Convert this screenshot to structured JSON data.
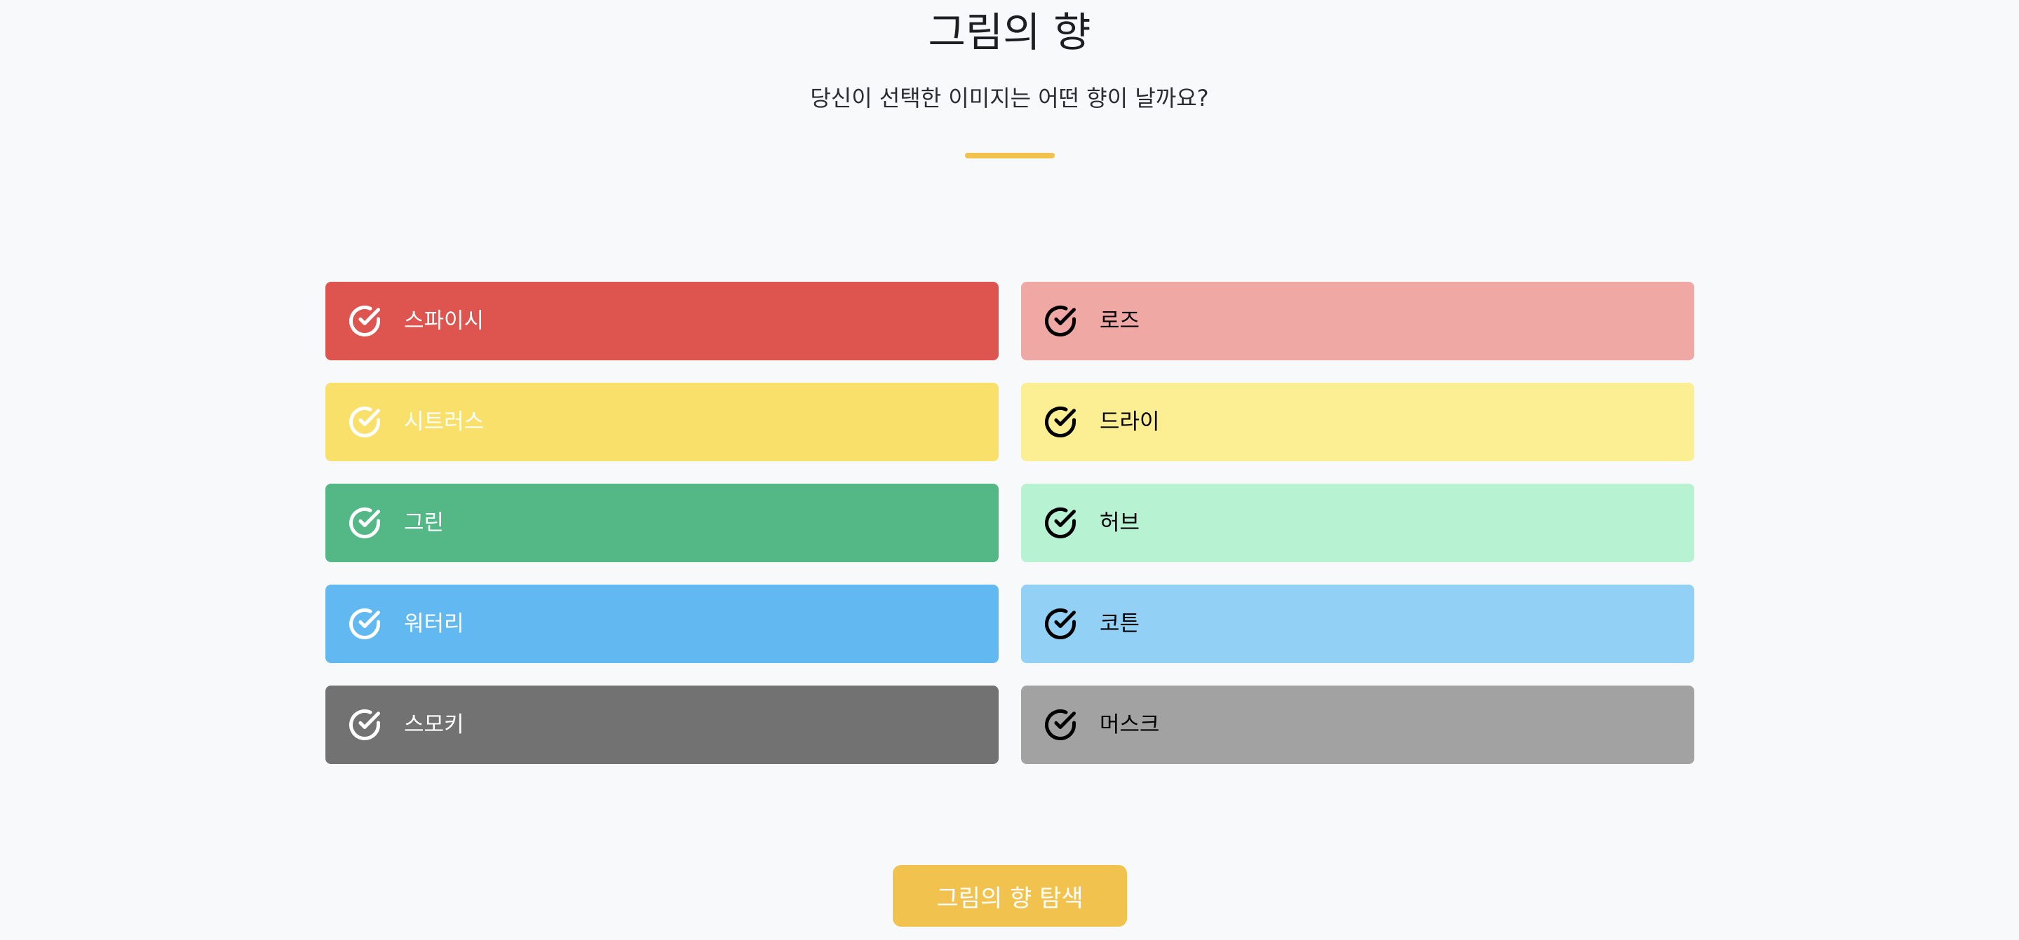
{
  "header": {
    "title": "그림의 향",
    "subtitle": "당신이 선택한 이미지는 어떤 향이 날까요?",
    "divider_color": "#f1c24e"
  },
  "scents": [
    {
      "label": "스파이시",
      "bg": "#de544f",
      "fg": "#ffffff",
      "icon": "check-circle-icon"
    },
    {
      "label": "로즈",
      "bg": "#f0a8a5",
      "fg": "#000000",
      "icon": "check-circle-icon"
    },
    {
      "label": "시트러스",
      "bg": "#f8e06a",
      "fg": "#ffffff",
      "icon": "check-circle-icon"
    },
    {
      "label": "드라이",
      "bg": "#fcee92",
      "fg": "#000000",
      "icon": "check-circle-icon"
    },
    {
      "label": "그린",
      "bg": "#53b786",
      "fg": "#ffffff",
      "icon": "check-circle-icon"
    },
    {
      "label": "허브",
      "bg": "#b7f2d2",
      "fg": "#000000",
      "icon": "check-circle-icon"
    },
    {
      "label": "워터리",
      "bg": "#62b9f1",
      "fg": "#ffffff",
      "icon": "check-circle-icon"
    },
    {
      "label": "코튼",
      "bg": "#92d0f6",
      "fg": "#000000",
      "icon": "check-circle-icon"
    },
    {
      "label": "스모키",
      "bg": "#727272",
      "fg": "#ffffff",
      "icon": "check-circle-icon"
    },
    {
      "label": "머스크",
      "bg": "#a2a2a2",
      "fg": "#000000",
      "icon": "check-circle-icon"
    }
  ],
  "actions": {
    "search_label": "그림의 향 탐색",
    "search_bg": "#f1c24e"
  }
}
